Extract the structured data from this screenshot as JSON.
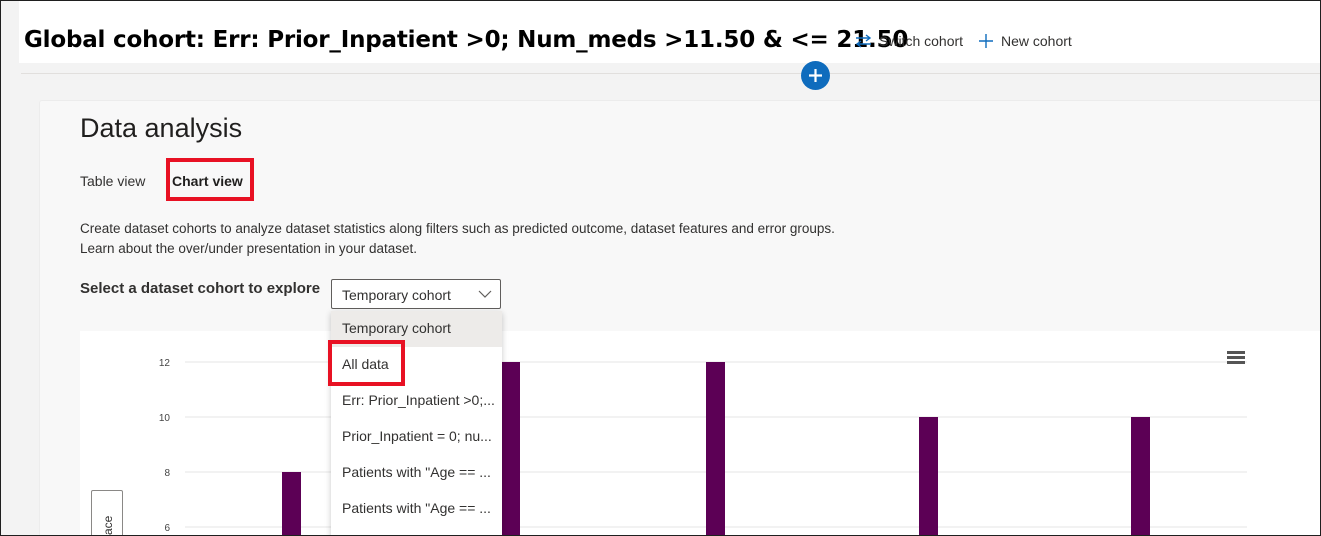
{
  "header": {
    "title": "Global cohort: Err: Prior_Inpatient >0; Num_meds >11.50 & <= 21.50",
    "switch_cohort": "Switch cohort",
    "new_cohort": "New cohort"
  },
  "section": {
    "title": "Data analysis",
    "tabs": [
      {
        "label": "Table view",
        "active": false
      },
      {
        "label": "Chart view",
        "active": true
      }
    ],
    "description": "Create dataset cohorts to analyze dataset statistics along filters such as predicted outcome, dataset features and error groups. Learn about the over/under presentation in your dataset.",
    "select_label": "Select a dataset cohort to explore",
    "dropdown": {
      "value": "Temporary cohort",
      "options": [
        "Temporary cohort",
        "All data",
        "Err: Prior_Inpatient >0;...",
        "Prior_Inpatient = 0; nu...",
        "Patients with \"Age == ...",
        "Patients with \"Age == ..."
      ]
    }
  },
  "chart_data": {
    "type": "bar",
    "y_ticks": [
      "12",
      "10",
      "8",
      "6"
    ],
    "values": [
      8,
      12,
      12,
      10,
      10
    ],
    "bar_color": "#5c0055",
    "y_axis_button_text": "ace"
  },
  "colors": {
    "accent": "#0f6cbd",
    "highlight_box": "#e81123"
  }
}
